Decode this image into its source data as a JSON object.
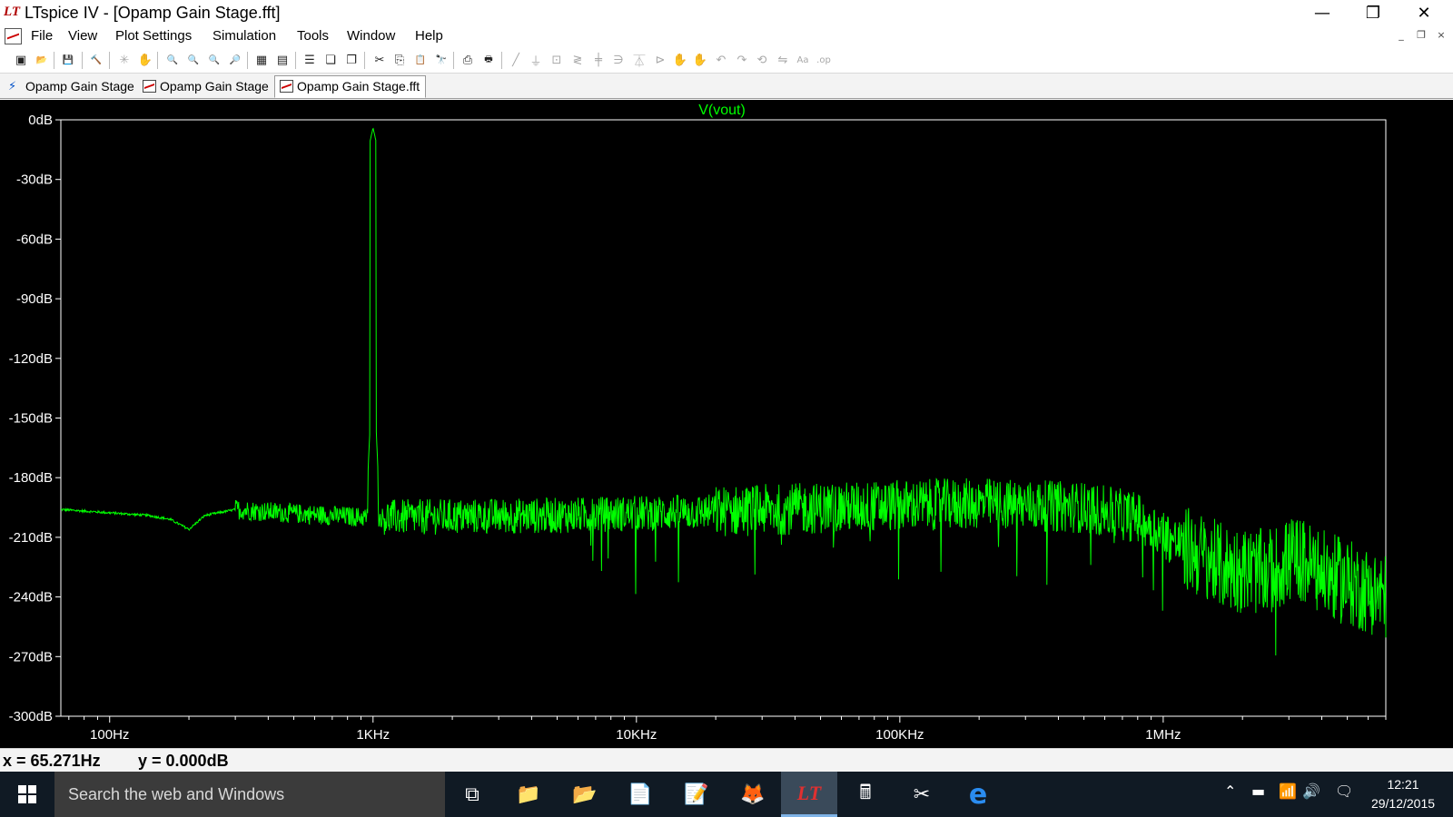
{
  "window": {
    "logo_text": "LT",
    "title": "LTspice IV - [Opamp Gain Stage.fft]",
    "minimize_glyph": "—",
    "restore_glyph": "❐",
    "close_glyph": "✕"
  },
  "menu": {
    "items": [
      "File",
      "View",
      "Plot Settings",
      "Simulation",
      "Tools",
      "Window",
      "Help"
    ],
    "mdi_minimize": "_",
    "mdi_restore": "❐",
    "mdi_close": "×"
  },
  "toolbar": {
    "buttons": [
      {
        "icon": "new-schematic-icon",
        "glyph": "▣",
        "enabled": true
      },
      {
        "icon": "open-icon",
        "glyph": "📂",
        "enabled": true
      },
      {
        "icon": "save-icon",
        "glyph": "💾",
        "enabled": true
      },
      {
        "icon": "control-panel-icon",
        "glyph": "🔨",
        "enabled": true
      },
      {
        "icon": "run-icon",
        "glyph": "✳",
        "enabled": false
      },
      {
        "icon": "pan-icon",
        "glyph": "✋",
        "enabled": false
      },
      {
        "icon": "zoom-in-icon",
        "glyph": "🔍",
        "enabled": true
      },
      {
        "icon": "zoom-out-icon",
        "glyph": "🔍",
        "enabled": true
      },
      {
        "icon": "zoom-back-icon",
        "glyph": "🔍",
        "enabled": true
      },
      {
        "icon": "zoom-fit-icon",
        "glyph": "🔎",
        "enabled": true
      },
      {
        "icon": "autorange-icon",
        "glyph": "▦",
        "enabled": true
      },
      {
        "icon": "fit-icon",
        "glyph": "▤",
        "enabled": true
      },
      {
        "icon": "tile-horizontal-icon",
        "glyph": "☰",
        "enabled": true
      },
      {
        "icon": "cascade-icon",
        "glyph": "❏",
        "enabled": true
      },
      {
        "icon": "tile-vertical-icon",
        "glyph": "❐",
        "enabled": true
      },
      {
        "icon": "cut-icon",
        "glyph": "✂",
        "enabled": true
      },
      {
        "icon": "copy-icon",
        "glyph": "⎘",
        "enabled": true
      },
      {
        "icon": "paste-icon",
        "glyph": "📋",
        "enabled": true
      },
      {
        "icon": "find-icon",
        "glyph": "🔭",
        "enabled": true
      },
      {
        "icon": "print-preview-icon",
        "glyph": "⎙",
        "enabled": true
      },
      {
        "icon": "print-icon",
        "glyph": "🖶",
        "enabled": true
      },
      {
        "icon": "wire-icon",
        "glyph": "╱",
        "enabled": false
      },
      {
        "icon": "ground-icon",
        "glyph": "⏚",
        "enabled": false
      },
      {
        "icon": "label-net-icon",
        "glyph": "⊡",
        "enabled": false
      },
      {
        "icon": "resistor-icon",
        "glyph": "≷",
        "enabled": false
      },
      {
        "icon": "capacitor-icon",
        "glyph": "╪",
        "enabled": false
      },
      {
        "icon": "inductor-icon",
        "glyph": "∋",
        "enabled": false
      },
      {
        "icon": "diode-icon",
        "glyph": "⏄",
        "enabled": false
      },
      {
        "icon": "component-icon",
        "glyph": "⊳",
        "enabled": false
      },
      {
        "icon": "move-icon",
        "glyph": "✋",
        "enabled": false
      },
      {
        "icon": "drag-icon",
        "glyph": "✋",
        "enabled": false
      },
      {
        "icon": "undo-icon",
        "glyph": "↶",
        "enabled": false
      },
      {
        "icon": "redo-icon",
        "glyph": "↷",
        "enabled": false
      },
      {
        "icon": "rotate-icon",
        "glyph": "⟲",
        "enabled": false
      },
      {
        "icon": "mirror-icon",
        "glyph": "⇋",
        "enabled": false
      },
      {
        "icon": "text-icon",
        "glyph": "Aa",
        "enabled": false
      },
      {
        "icon": "spice-directive-icon",
        "glyph": ".op",
        "enabled": false
      }
    ]
  },
  "tabs": [
    {
      "label": "Opamp Gain Stage",
      "kind": "schematic",
      "icon_glyph": "⚡",
      "active": false
    },
    {
      "label": "Opamp Gain Stage",
      "kind": "plot",
      "icon_glyph": "",
      "active": false
    },
    {
      "label": "Opamp Gain Stage.fft",
      "kind": "plot",
      "icon_glyph": "",
      "active": true
    }
  ],
  "chart_data": {
    "type": "line",
    "trace_name": "V(vout)",
    "trace_color": "#00ff00",
    "background": "#000000",
    "axis_color": "#ffffff",
    "x_scale": "log",
    "xlim": [
      65.271,
      7000000
    ],
    "x_tick_labels": [
      {
        "value": 100,
        "label": "100Hz"
      },
      {
        "value": 1000,
        "label": "1KHz"
      },
      {
        "value": 10000,
        "label": "10KHz"
      },
      {
        "value": 100000,
        "label": "100KHz"
      },
      {
        "value": 1000000,
        "label": "1MHz"
      }
    ],
    "ylim": [
      -300,
      0
    ],
    "y_tick_labels": [
      {
        "value": 0,
        "label": "0dB"
      },
      {
        "value": -30,
        "label": "-30dB"
      },
      {
        "value": -60,
        "label": "-60dB"
      },
      {
        "value": -90,
        "label": "-90dB"
      },
      {
        "value": -120,
        "label": "-120dB"
      },
      {
        "value": -150,
        "label": "-150dB"
      },
      {
        "value": -180,
        "label": "-180dB"
      },
      {
        "value": -210,
        "label": "-210dB"
      },
      {
        "value": -240,
        "label": "-240dB"
      },
      {
        "value": -270,
        "label": "-270dB"
      },
      {
        "value": -300,
        "label": "-300dB"
      }
    ],
    "grid": false,
    "peak": {
      "freq": 1000,
      "db": -4
    },
    "floor_points": [
      {
        "f": 65,
        "db": -196
      },
      {
        "f": 140,
        "db": -199
      },
      {
        "f": 170,
        "db": -201
      },
      {
        "f": 200,
        "db": -206
      },
      {
        "f": 230,
        "db": -199
      },
      {
        "f": 300,
        "db": -196
      },
      {
        "f": 500,
        "db": -198
      },
      {
        "f": 950,
        "db": -200
      },
      {
        "f": 1100,
        "db": -200
      },
      {
        "f": 5000,
        "db": -199
      },
      {
        "f": 20000,
        "db": -197
      },
      {
        "f": 100000,
        "db": -194
      },
      {
        "f": 200000,
        "db": -193
      },
      {
        "f": 500000,
        "db": -195
      },
      {
        "f": 800000,
        "db": -200
      },
      {
        "f": 1200000,
        "db": -215
      },
      {
        "f": 1700000,
        "db": -225
      },
      {
        "f": 2500000,
        "db": -228
      },
      {
        "f": 3200000,
        "db": -220
      },
      {
        "f": 4000000,
        "db": -228
      },
      {
        "f": 7000000,
        "db": -240
      }
    ]
  },
  "status": {
    "cursor_x": "x = 65.271Hz",
    "cursor_y": "y = 0.000dB"
  },
  "taskbar": {
    "search_placeholder": "Search the web and Windows",
    "apps": [
      {
        "name": "task-view-icon",
        "glyph": "⧉",
        "active": false
      },
      {
        "name": "file-explorer-icon",
        "glyph": "📁",
        "active": false
      },
      {
        "name": "folder-icon",
        "glyph": "📂",
        "active": false
      },
      {
        "name": "document-icon",
        "glyph": "📄",
        "active": false
      },
      {
        "name": "notepad-icon",
        "glyph": "📝",
        "active": false
      },
      {
        "name": "fox-app-icon",
        "glyph": "🦊",
        "active": false
      },
      {
        "name": "ltspice-icon",
        "glyph": "LT",
        "active": true
      },
      {
        "name": "calculator-icon",
        "glyph": "🖩",
        "active": false
      },
      {
        "name": "snipping-tool-icon",
        "glyph": "✂",
        "active": false
      },
      {
        "name": "edge-browser-icon",
        "glyph": "e",
        "active": false
      }
    ],
    "tray": [
      {
        "name": "show-hidden-icon",
        "glyph": "⌃"
      },
      {
        "name": "battery-icon",
        "glyph": "▬"
      },
      {
        "name": "network-icon",
        "glyph": "📶"
      },
      {
        "name": "volume-icon",
        "glyph": "🔊"
      },
      {
        "name": "notifications-icon",
        "glyph": "🗨"
      }
    ],
    "time": "12:21",
    "date": "29/12/2015"
  }
}
